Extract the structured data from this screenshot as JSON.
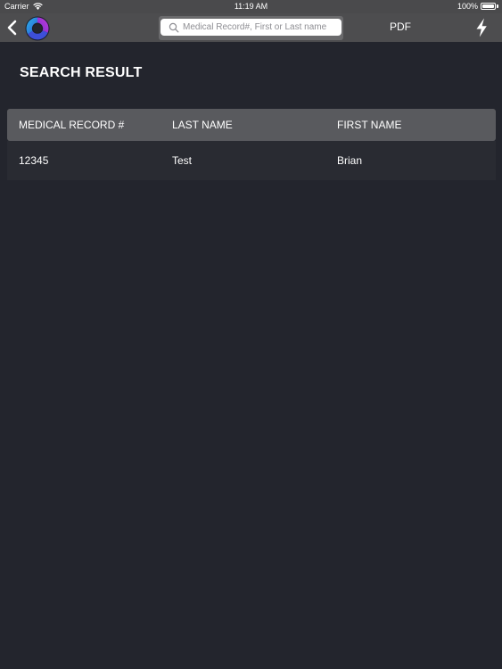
{
  "status_bar": {
    "carrier": "Carrier",
    "time": "11:19 AM",
    "battery": "100%",
    "battery_level": 1.0
  },
  "nav": {
    "back_icon": "chevron-left-icon",
    "logo_icon": "app-logo-icon",
    "search": {
      "placeholder": "Medical Record#, First or Last name",
      "value": ""
    },
    "pdf_label": "PDF",
    "flash_icon": "lightning-bolt-icon"
  },
  "page": {
    "title": "SEARCH RESULT"
  },
  "table": {
    "columns": [
      "MEDICAL RECORD #",
      "LAST NAME",
      "FIRST NAME"
    ],
    "rows": [
      {
        "medical_record": "12345",
        "last_name": "Test",
        "first_name": "Brian"
      }
    ]
  },
  "colors": {
    "background": "#23252d",
    "nav_bar": "#4d4d4f",
    "table_header": "#595a5e",
    "table_row": "#292b32"
  }
}
